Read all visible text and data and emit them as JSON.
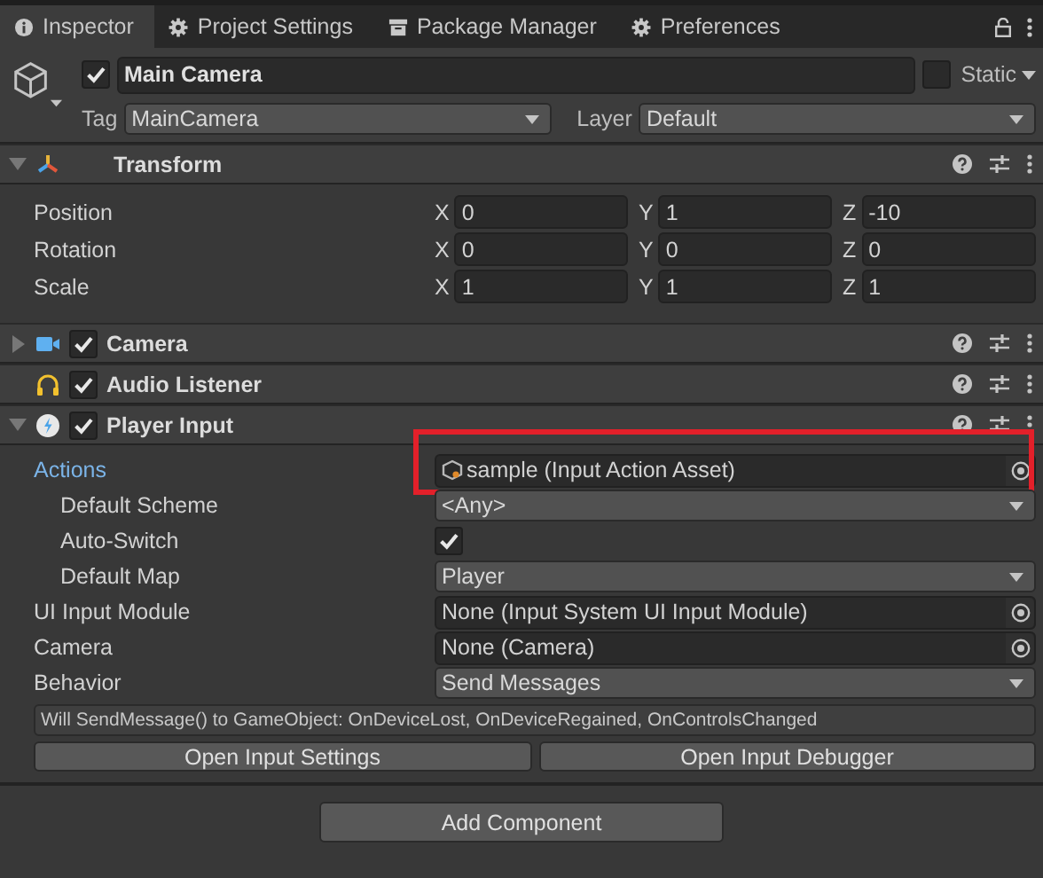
{
  "tabs": [
    {
      "label": "Inspector",
      "kind": "info",
      "selected": true
    },
    {
      "label": "Project Settings",
      "kind": "gear",
      "selected": false
    },
    {
      "label": "Package Manager",
      "kind": "package",
      "selected": false
    },
    {
      "label": "Preferences",
      "kind": "gear",
      "selected": false
    }
  ],
  "object": {
    "active": true,
    "name": "Main Camera",
    "static": false,
    "static_label": "Static",
    "tag_label": "Tag",
    "tag": "MainCamera",
    "layer_label": "Layer",
    "layer": "Default"
  },
  "transform": {
    "name": "Transform",
    "kind": "axes",
    "expanded": true,
    "rows": [
      {
        "label": "Position",
        "axes": [
          {
            "label": "X",
            "value": "0"
          },
          {
            "label": "Y",
            "value": "1"
          },
          {
            "label": "Z",
            "value": "-10"
          }
        ]
      },
      {
        "label": "Rotation",
        "axes": [
          {
            "label": "X",
            "value": "0"
          },
          {
            "label": "Y",
            "value": "0"
          },
          {
            "label": "Z",
            "value": "0"
          }
        ]
      },
      {
        "label": "Scale",
        "axes": [
          {
            "label": "X",
            "value": "1"
          },
          {
            "label": "Y",
            "value": "1"
          },
          {
            "label": "Z",
            "value": "1"
          }
        ]
      }
    ]
  },
  "components": [
    {
      "name": "Camera",
      "kind": "camera",
      "expanded": false,
      "enabled": true
    },
    {
      "name": "Audio Listener",
      "kind": "headphones",
      "enabled": true
    },
    {
      "name": "Player Input",
      "kind": "input",
      "expanded": true,
      "enabled": true
    }
  ],
  "player_input": {
    "fields": [
      {
        "label": "Actions",
        "kind": "asset",
        "value": "sample (Input Action Asset)",
        "selected": true,
        "highlighted": true,
        "children": [
          {
            "label": "Default Scheme",
            "kind": "dropdown",
            "value": "<Any>",
            "selected": false
          },
          {
            "label": "Auto-Switch",
            "kind": "checkbox",
            "checked": true,
            "selected": false
          },
          {
            "label": "Default Map",
            "kind": "dropdown",
            "value": "Player",
            "selected": false
          }
        ]
      },
      {
        "label": "UI Input Module",
        "kind": "object",
        "value": "None (Input System UI Input Module)",
        "selected": false
      },
      {
        "label": "Camera",
        "kind": "object",
        "value": "None (Camera)",
        "selected": false
      },
      {
        "label": "Behavior",
        "kind": "dropdown",
        "value": "Send Messages",
        "selected": false
      }
    ],
    "message": "Will SendMessage() to GameObject: OnDeviceLost, OnDeviceRegained, OnControlsChanged",
    "buttons": [
      "Open Input Settings",
      "Open Input Debugger"
    ]
  },
  "add_component": "Add Component"
}
